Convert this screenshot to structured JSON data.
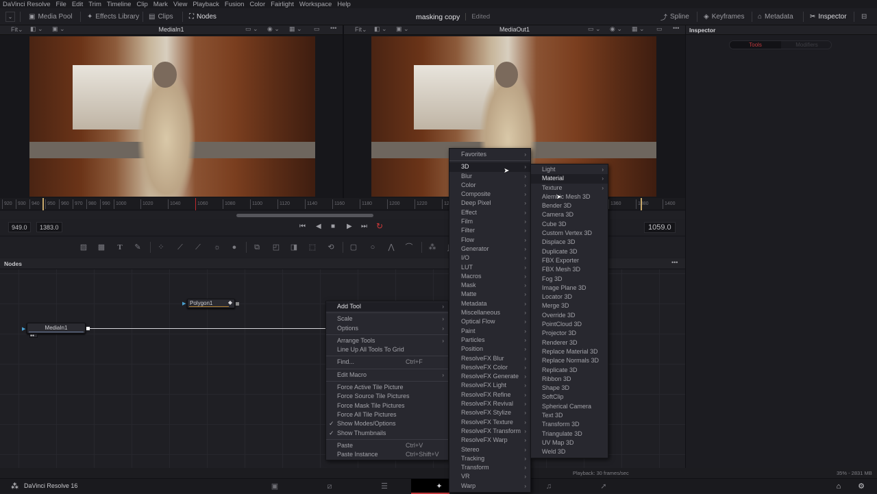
{
  "menubar": [
    "DaVinci Resolve",
    "File",
    "Edit",
    "Trim",
    "Timeline",
    "Clip",
    "Mark",
    "View",
    "Playback",
    "Fusion",
    "Color",
    "Fairlight",
    "Workspace",
    "Help"
  ],
  "toolbar": {
    "media_pool": "Media Pool",
    "effects_library": "Effects Library",
    "clips": "Clips",
    "nodes": "Nodes",
    "project_title": "masking copy",
    "project_status": "Edited",
    "spline": "Spline",
    "keyframes": "Keyframes",
    "metadata": "Metadata",
    "inspector": "Inspector"
  },
  "viewer_left": {
    "fit": "Fit",
    "title": "MediaIn1"
  },
  "viewer_right": {
    "fit": "Fit",
    "title": "MediaOut1"
  },
  "ruler": {
    "ticks": [
      "920",
      "930",
      "940",
      "950",
      "960",
      "970",
      "980",
      "990",
      "1000",
      "1020",
      "1040",
      "1060",
      "1080",
      "1100",
      "1120",
      "1140",
      "1160",
      "1180",
      "1200",
      "1220",
      "12",
      "1360",
      "1380",
      "1400"
    ]
  },
  "transport": {
    "start": "949.0",
    "end": "1383.0",
    "current": "1059.0",
    "colors": {
      "loop": "#d23a3a",
      "playhead": "#c0282c",
      "in_marker": "#c8a86a"
    }
  },
  "nodes_panel": {
    "title": "Nodes",
    "node_polygon": "Polygon1",
    "node_mediain": "MediaIn1"
  },
  "inspector": {
    "title": "Inspector",
    "tab_tools": "Tools",
    "tab_modifiers": "Modifiers",
    "tab_active_color": "#c0383c"
  },
  "context_menu": {
    "items": [
      {
        "label": "Add Tool",
        "arrow": true,
        "highlight": true
      },
      {
        "sep": true
      },
      {
        "label": "Scale",
        "arrow": true
      },
      {
        "label": "Options",
        "arrow": true
      },
      {
        "sep": true
      },
      {
        "label": "Arrange Tools",
        "arrow": true
      },
      {
        "label": "Line Up All Tools To Grid"
      },
      {
        "sep": true
      },
      {
        "label": "Find...",
        "shortcut": "Ctrl+F"
      },
      {
        "sep": true
      },
      {
        "label": "Edit Macro",
        "arrow": true
      },
      {
        "sep": true
      },
      {
        "label": "Force Active Tile Picture"
      },
      {
        "label": "Force Source Tile Pictures"
      },
      {
        "label": "Force Mask Tile Pictures"
      },
      {
        "label": "Force All Tile Pictures"
      },
      {
        "label": "Show Modes/Options",
        "checked": true
      },
      {
        "label": "Show Thumbnails",
        "checked": true
      },
      {
        "sep": true
      },
      {
        "label": "Paste",
        "shortcut": "Ctrl+V"
      },
      {
        "label": "Paste Instance",
        "shortcut": "Ctrl+Shift+V"
      }
    ]
  },
  "add_tool_menu": {
    "items": [
      {
        "label": "Favorites"
      },
      {
        "sep": true
      },
      {
        "label": "3D",
        "highlight": true
      },
      {
        "label": "Blur"
      },
      {
        "label": "Color"
      },
      {
        "label": "Composite"
      },
      {
        "label": "Deep Pixel"
      },
      {
        "label": "Effect"
      },
      {
        "label": "Film"
      },
      {
        "label": "Filter"
      },
      {
        "label": "Flow"
      },
      {
        "label": "Generator"
      },
      {
        "label": "I/O"
      },
      {
        "label": "LUT"
      },
      {
        "label": "Macros"
      },
      {
        "label": "Mask"
      },
      {
        "label": "Matte"
      },
      {
        "label": "Metadata"
      },
      {
        "label": "Miscellaneous"
      },
      {
        "label": "Optical Flow"
      },
      {
        "label": "Paint"
      },
      {
        "label": "Particles"
      },
      {
        "label": "Position"
      },
      {
        "label": "ResolveFX Blur"
      },
      {
        "label": "ResolveFX Color"
      },
      {
        "label": "ResolveFX Generate"
      },
      {
        "label": "ResolveFX Light"
      },
      {
        "label": "ResolveFX Refine"
      },
      {
        "label": "ResolveFX Revival"
      },
      {
        "label": "ResolveFX Stylize"
      },
      {
        "label": "ResolveFX Texture"
      },
      {
        "label": "ResolveFX Transform"
      },
      {
        "label": "ResolveFX Warp"
      },
      {
        "label": "Stereo"
      },
      {
        "label": "Tracking"
      },
      {
        "label": "Transform"
      },
      {
        "label": "VR"
      },
      {
        "label": "Warp"
      }
    ]
  },
  "menu_3d": {
    "items": [
      {
        "label": "Light",
        "arrow": true
      },
      {
        "label": "Material",
        "arrow": true,
        "highlight": true
      },
      {
        "label": "Texture",
        "arrow": true
      },
      {
        "label": "Alembic Mesh 3D"
      },
      {
        "label": "Bender 3D"
      },
      {
        "label": "Camera 3D"
      },
      {
        "label": "Cube 3D"
      },
      {
        "label": "Custom Vertex 3D"
      },
      {
        "label": "Displace 3D"
      },
      {
        "label": "Duplicate 3D"
      },
      {
        "label": "FBX Exporter"
      },
      {
        "label": "FBX Mesh 3D"
      },
      {
        "label": "Fog 3D"
      },
      {
        "label": "Image Plane 3D"
      },
      {
        "label": "Locator 3D"
      },
      {
        "label": "Merge 3D"
      },
      {
        "label": "Override 3D"
      },
      {
        "label": "PointCloud 3D"
      },
      {
        "label": "Projector 3D"
      },
      {
        "label": "Renderer 3D"
      },
      {
        "label": "Replace Material 3D"
      },
      {
        "label": "Replace Normals 3D"
      },
      {
        "label": "Replicate 3D"
      },
      {
        "label": "Ribbon 3D"
      },
      {
        "label": "Shape 3D"
      },
      {
        "label": "SoftClip"
      },
      {
        "label": "Spherical Camera"
      },
      {
        "label": "Text 3D"
      },
      {
        "label": "Transform 3D"
      },
      {
        "label": "Triangulate 3D"
      },
      {
        "label": "UV Map 3D"
      },
      {
        "label": "Weld 3D"
      }
    ]
  },
  "status": {
    "playback": "Playback: 30 frames/sec",
    "memory": "35% - 2831 MB"
  },
  "pagebar": {
    "app_name": "DaVinci Resolve 16",
    "active_page_color": "#c0383c"
  }
}
